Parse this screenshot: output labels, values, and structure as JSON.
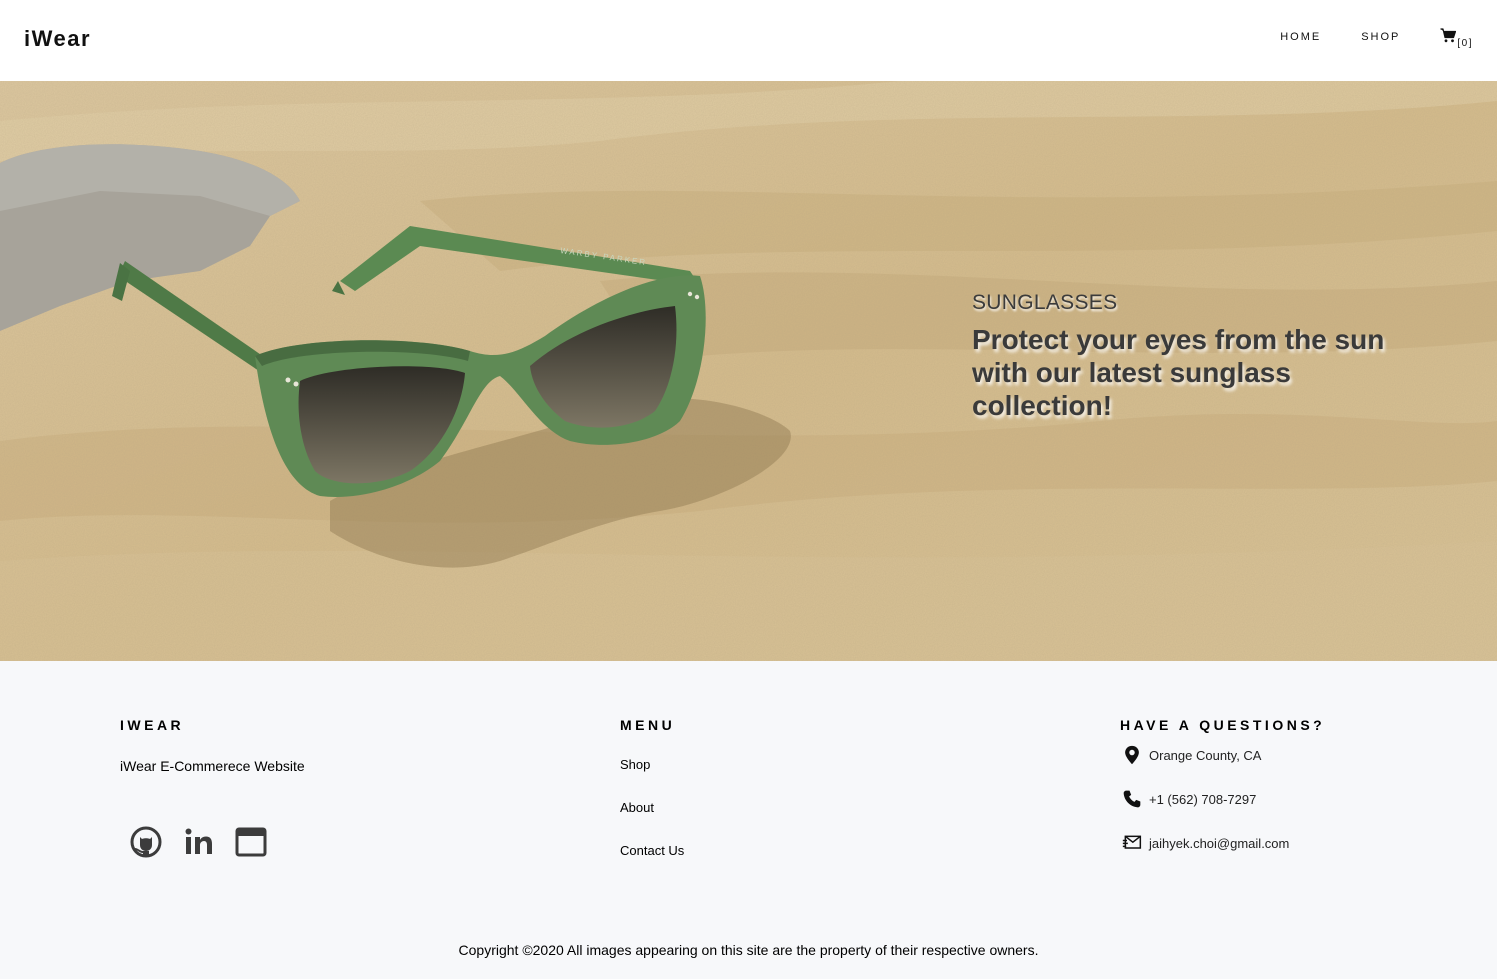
{
  "header": {
    "brand": "iWear",
    "nav": {
      "home": "HOME",
      "shop": "SHOP",
      "cart_count": "[0]"
    }
  },
  "hero": {
    "kicker": "SUNGLASSES",
    "headline": "Protect your eyes from the sun with our latest sunglass collection!",
    "frame_print": "WARBY PARKER"
  },
  "footer": {
    "about": {
      "title": "IWEAR",
      "description": "iWear E-Commerece Website",
      "socials": [
        "github-icon",
        "linkedin-icon",
        "website-icon"
      ]
    },
    "menu": {
      "title": "MENU",
      "items": [
        "Shop",
        "About",
        "Contact Us"
      ]
    },
    "contact": {
      "title": "HAVE A QUESTIONS?",
      "location": "Orange County, CA",
      "phone": "+1 (562) 708-7297",
      "email": "jaihyek.choi@gmail.com"
    },
    "copyright": "Copyright ©2020 All images appearing on this site are the property of their respective owners."
  },
  "colors": {
    "sand": "#d6bd8f",
    "frame_green": "#5f8a55",
    "footer_bg": "#f7f8fa",
    "text_dark": "#3a3a3a",
    "icon_dark": "#3c3c3c"
  }
}
